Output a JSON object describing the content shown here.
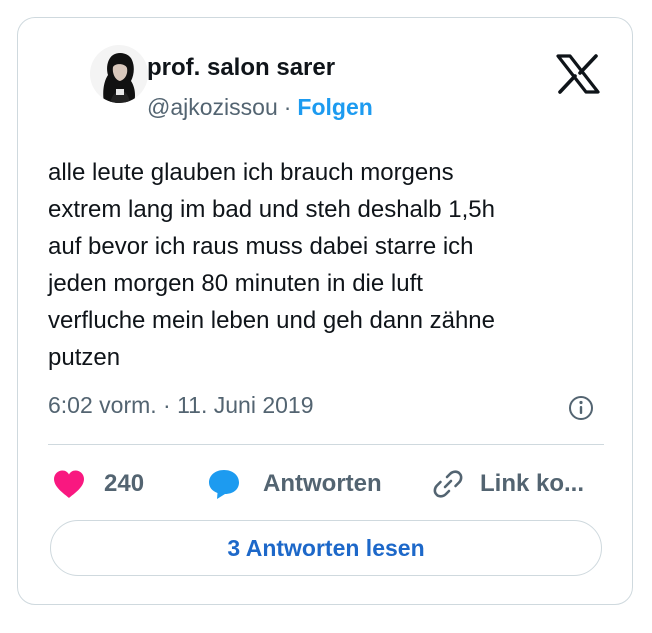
{
  "author": {
    "name": "prof. salon sarer",
    "handle": "@ajkozissou",
    "separator": "·",
    "follow_label": "Folgen"
  },
  "tweet": {
    "lines": [
      "alle leute glauben ich brauch morgens",
      "extrem lang im bad und steh deshalb 1,5h",
      "auf bevor ich raus muss dabei starre ich",
      "jeden morgen 80 minuten in die luft",
      "verfluche mein leben und geh dann zähne",
      "putzen"
    ],
    "timestamp": "6:02 vorm. · 11. Juni 2019"
  },
  "actions": {
    "like_count": "240",
    "reply_label": "Antworten",
    "link_label": "Link ko..."
  },
  "read_replies_label": "3 Antworten lesen",
  "icons": {
    "logo": "x-logo-icon",
    "info": "info-icon",
    "like": "heart-icon",
    "reply": "speech-bubble-icon",
    "link": "link-icon"
  },
  "colors": {
    "like": "#f91880",
    "reply": "#1d9bf0",
    "follow": "#1d9bf0",
    "read_button_text": "#1d68c9",
    "secondary_text": "#536471"
  }
}
